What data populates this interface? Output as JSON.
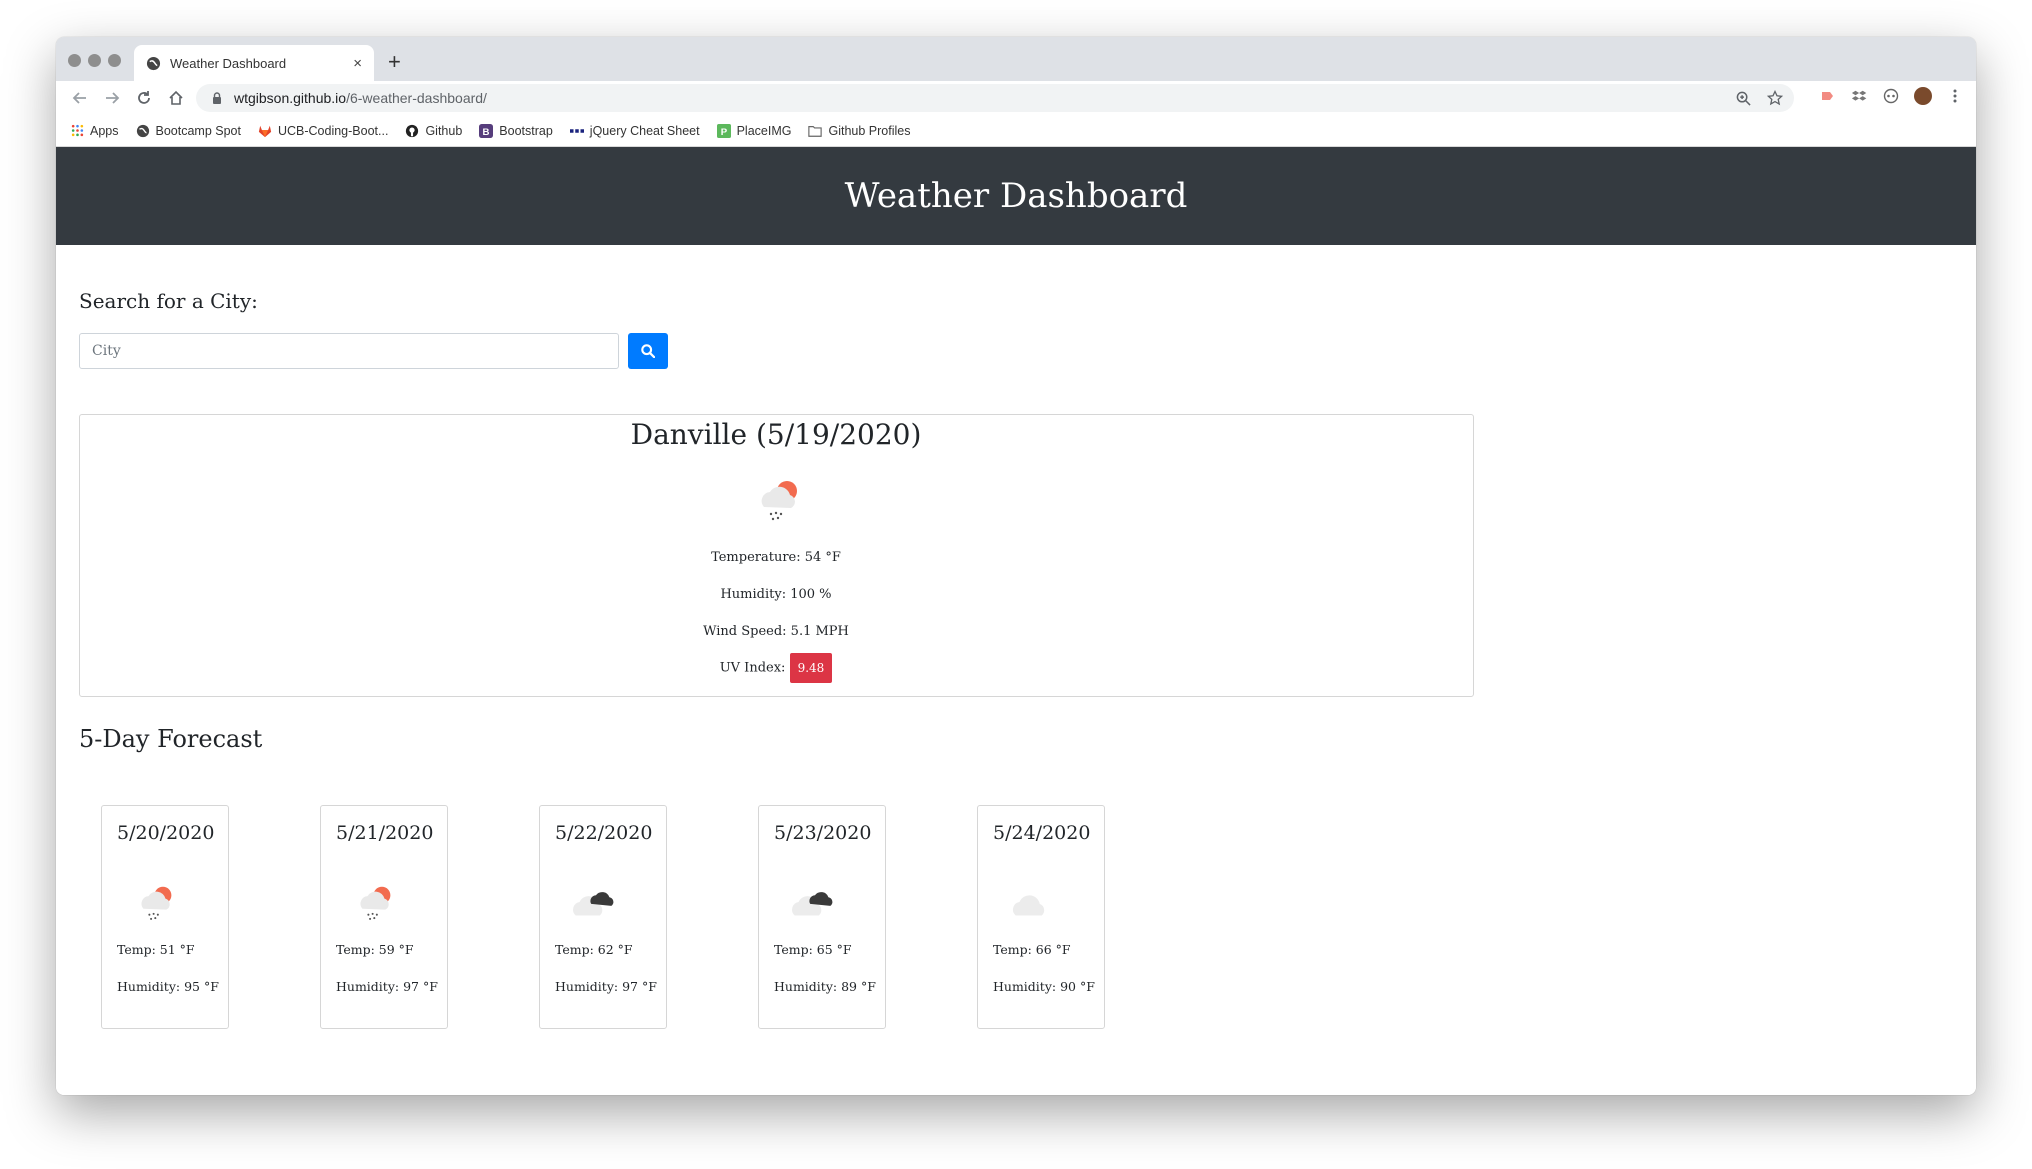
{
  "browser": {
    "tab_title": "Weather Dashboard",
    "tab_close": "×",
    "new_tab": "+",
    "url_host": "wtgibson.github.io",
    "url_path": "/6-weather-dashboard/",
    "bookmarks": [
      {
        "label": "Apps",
        "icon": "apps-grid-icon"
      },
      {
        "label": "Bootcamp Spot",
        "icon": "globe-icon"
      },
      {
        "label": "UCB-Coding-Boot...",
        "icon": "gitlab-icon"
      },
      {
        "label": "Github",
        "icon": "github-icon"
      },
      {
        "label": "Bootstrap",
        "icon": "bootstrap-icon"
      },
      {
        "label": "jQuery Cheat Sheet",
        "icon": "dots-icon"
      },
      {
        "label": "PlaceIMG",
        "icon": "placeimg-icon"
      },
      {
        "label": "Github Profiles",
        "icon": "folder-icon"
      }
    ]
  },
  "header": {
    "title": "Weather Dashboard"
  },
  "search": {
    "label": "Search for a City:",
    "placeholder": "City"
  },
  "current": {
    "city_date": "Danville (5/19/2020)",
    "icon": "rain-sun-icon",
    "temperature": "Temperature: 54 °F",
    "humidity": "Humidity: 100 %",
    "wind": "Wind Speed: 5.1 MPH",
    "uv_label": "UV Index:",
    "uv_value": "9.48"
  },
  "forecast": {
    "title": "5-Day Forecast",
    "days": [
      {
        "date": "5/20/2020",
        "icon": "rain-sun-icon",
        "temp": "Temp: 51 °F",
        "humidity": "Humidity: 95 °F"
      },
      {
        "date": "5/21/2020",
        "icon": "rain-sun-icon",
        "temp": "Temp: 59 °F",
        "humidity": "Humidity: 97 °F"
      },
      {
        "date": "5/22/2020",
        "icon": "broken-clouds-icon",
        "temp": "Temp: 62 °F",
        "humidity": "Humidity: 97 °F"
      },
      {
        "date": "5/23/2020",
        "icon": "broken-clouds-icon",
        "temp": "Temp: 65 °F",
        "humidity": "Humidity: 89 °F"
      },
      {
        "date": "5/24/2020",
        "icon": "cloud-icon",
        "temp": "Temp: 66 °F",
        "humidity": "Humidity: 90 °F"
      }
    ]
  },
  "colors": {
    "header_bg": "#343a40",
    "button_primary": "#007bff",
    "uv_danger": "#dc3545"
  }
}
